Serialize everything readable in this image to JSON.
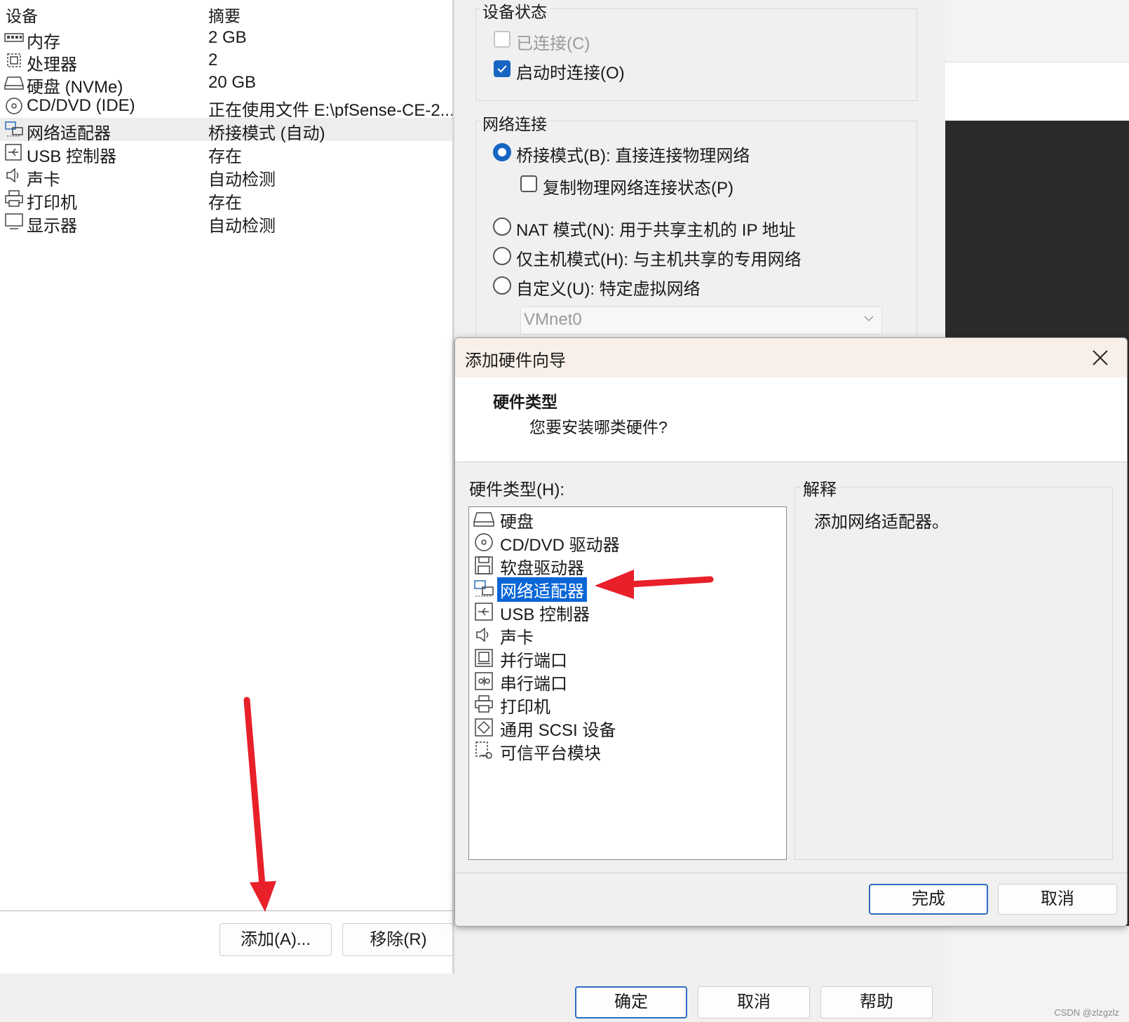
{
  "left": {
    "header_device": "设备",
    "header_summary": "摘要",
    "devices": [
      {
        "name": "内存",
        "summary": "2 GB",
        "icon": "memory-icon"
      },
      {
        "name": "处理器",
        "summary": "2",
        "icon": "cpu-icon"
      },
      {
        "name": "硬盘 (NVMe)",
        "summary": "20 GB",
        "icon": "harddisk-icon"
      },
      {
        "name": "CD/DVD (IDE)",
        "summary": "正在使用文件 E:\\pfSense-CE-2...",
        "icon": "cd-icon"
      },
      {
        "name": "网络适配器",
        "summary": "桥接模式 (自动)",
        "icon": "network-icon"
      },
      {
        "name": "USB 控制器",
        "summary": "存在",
        "icon": "usb-icon"
      },
      {
        "name": "声卡",
        "summary": "自动检测",
        "icon": "sound-icon"
      },
      {
        "name": "打印机",
        "summary": "存在",
        "icon": "printer-icon"
      },
      {
        "name": "显示器",
        "summary": "自动检测",
        "icon": "display-icon"
      }
    ],
    "add_button": "添加(A)...",
    "remove_button": "移除(R)"
  },
  "settings": {
    "device_status_title": "设备状态",
    "connected_label": "已连接(C)",
    "connect_on_start_label": "启动时连接(O)",
    "network_title": "网络连接",
    "bridged_label": "桥接模式(B): 直接连接物理网络",
    "replicate_label": "复制物理网络连接状态(P)",
    "nat_label": "NAT 模式(N): 用于共享主机的 IP 地址",
    "hostonly_label": "仅主机模式(H): 与主机共享的专用网络",
    "custom_label": "自定义(U): 特定虚拟网络",
    "vmnet_value": "VMnet0"
  },
  "bottom": {
    "ok_button": "确定",
    "cancel_button": "取消",
    "help_button": "帮助"
  },
  "dialog": {
    "title": "添加硬件向导",
    "heading": "硬件类型",
    "subheading": "您要安装哪类硬件?",
    "hw_type_label": "硬件类型(H):",
    "explain_title": "解释",
    "explain_text": "添加网络适配器。",
    "items": [
      {
        "label": "硬盘",
        "icon": "harddisk-icon"
      },
      {
        "label": "CD/DVD 驱动器",
        "icon": "cd-icon"
      },
      {
        "label": "软盘驱动器",
        "icon": "floppy-icon"
      },
      {
        "label": "网络适配器",
        "icon": "network-icon"
      },
      {
        "label": "USB 控制器",
        "icon": "usb-icon"
      },
      {
        "label": "声卡",
        "icon": "sound-icon"
      },
      {
        "label": "并行端口",
        "icon": "parallel-port-icon"
      },
      {
        "label": "串行端口",
        "icon": "serial-port-icon"
      },
      {
        "label": "打印机",
        "icon": "printer-icon"
      },
      {
        "label": "通用 SCSI 设备",
        "icon": "scsi-icon"
      },
      {
        "label": "可信平台模块",
        "icon": "tpm-icon"
      }
    ],
    "finish_button": "完成",
    "cancel_button": "取消"
  },
  "watermark": "CSDN @zlzgzlz",
  "colors": {
    "accent": "#1665c1",
    "selection": "#0a66d6",
    "annotation_arrow": "#e8202a"
  }
}
